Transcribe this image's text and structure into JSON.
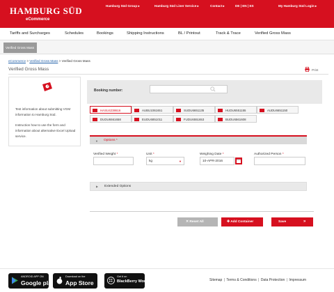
{
  "header": {
    "logo_main": "HAMBURG SÜD",
    "logo_sub": "eCommerce",
    "nav": {
      "group": "Hamburg Süd Group",
      "liner": "Hamburg Süd Liner Service",
      "contact": "Contact",
      "lang": "DE | EN | ES",
      "login": "My Hamburg Süd Login"
    }
  },
  "main_nav": [
    "Tariffs and Surcharges",
    "Schedules",
    "Bookings",
    "Shipping Instructions",
    "BL / Printout",
    "Track & Trace",
    "Verified Gross Mass"
  ],
  "sub_nav": {
    "active_tab": "Verified Gross Mass"
  },
  "breadcrumb": {
    "home": "eCommerce",
    "sep1": ">",
    "parent": "Verified Gross Mass",
    "sep2": ">",
    "current": "Verified Gross Mass"
  },
  "page": {
    "title": "Verified Gross Mass",
    "print": "Print"
  },
  "info": {
    "text1": "Test information about submitting VGM information to Hamburg Süd.",
    "text2": "Instruction how to use the form and information about alternative Excel Upload service."
  },
  "form": {
    "booking_label": "Booking number:",
    "booking_value": "",
    "containers": [
      "HASU4238616",
      "AUBU1061651",
      "SUDU6651135",
      "HUDU6551155",
      "AUDU6651150",
      "DUDU6561658",
      "EUDU6851011",
      "FUDU6551653",
      "BUDU6561608"
    ],
    "options_label": "Options",
    "fields": {
      "weight_label": "Verified Weight",
      "weight_value": "",
      "unit_label": "Unit",
      "unit_value": "kg",
      "date_label": "Weighing Date",
      "date_value": "10-APR-2016",
      "person_label": "Authorized Person",
      "person_value": ""
    },
    "required_mark": "*",
    "extended_label": "Extended Options",
    "buttons": {
      "reset": "Reset All",
      "add": "Add Container",
      "save": "Save"
    }
  },
  "footer": {
    "stores": [
      {
        "small": "ANDROID APP ON",
        "big": "Google play"
      },
      {
        "small": "Download on the",
        "big": "App Store"
      },
      {
        "small": "Get it on",
        "big": "BlackBerry World"
      }
    ],
    "links": [
      "Sitemap",
      "Terms & Conditions",
      "Data Protection",
      "Impressum"
    ]
  },
  "colors": {
    "brand_red": "#d6101f",
    "grey_button": "#b5b5b5",
    "panel_grey": "#e9e9e9"
  }
}
